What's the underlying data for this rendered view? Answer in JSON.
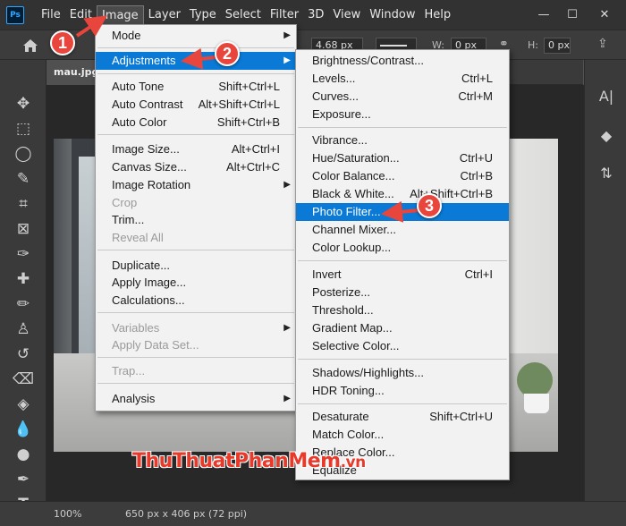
{
  "app": {
    "logo": "Ps"
  },
  "menubar": {
    "items": [
      "File",
      "Edit",
      "Image",
      "Layer",
      "Type",
      "Select",
      "Filter",
      "3D",
      "View",
      "Window",
      "Help"
    ],
    "active_index": 2
  },
  "window_controls": {
    "minimize": "—",
    "maximize": "☐",
    "close": "✕"
  },
  "options_bar": {
    "stroke_width": "4.68 px",
    "w_label": "W:",
    "w_value": "0 px",
    "h_label": "H:",
    "h_value": "0 px"
  },
  "document": {
    "tab_name": "mau.jpg"
  },
  "status": {
    "zoom": "100%",
    "info": "650 px x 406 px (72 ppi)"
  },
  "watermark": {
    "text": "ThuThuatPhanMem",
    "suffix": ".vn"
  },
  "image_menu": {
    "items": [
      {
        "label": "Mode",
        "shortcut": "",
        "submenu": true,
        "disabled": false
      },
      {
        "label": "Adjustments",
        "shortcut": "",
        "submenu": true,
        "disabled": false,
        "highlight": true
      },
      {
        "label": "Auto Tone",
        "shortcut": "Shift+Ctrl+L",
        "disabled": false
      },
      {
        "label": "Auto Contrast",
        "shortcut": "Alt+Shift+Ctrl+L",
        "disabled": false
      },
      {
        "label": "Auto Color",
        "shortcut": "Shift+Ctrl+B",
        "disabled": false
      },
      {
        "label": "Image Size...",
        "shortcut": "Alt+Ctrl+I",
        "disabled": false
      },
      {
        "label": "Canvas Size...",
        "shortcut": "Alt+Ctrl+C",
        "disabled": false
      },
      {
        "label": "Image Rotation",
        "shortcut": "",
        "submenu": true,
        "disabled": false
      },
      {
        "label": "Crop",
        "shortcut": "",
        "disabled": true
      },
      {
        "label": "Trim...",
        "shortcut": "",
        "disabled": false
      },
      {
        "label": "Reveal All",
        "shortcut": "",
        "disabled": true
      },
      {
        "label": "Duplicate...",
        "shortcut": "",
        "disabled": false
      },
      {
        "label": "Apply Image...",
        "shortcut": "",
        "disabled": false
      },
      {
        "label": "Calculations...",
        "shortcut": "",
        "disabled": false
      },
      {
        "label": "Variables",
        "shortcut": "",
        "submenu": true,
        "disabled": true
      },
      {
        "label": "Apply Data Set...",
        "shortcut": "",
        "disabled": true
      },
      {
        "label": "Trap...",
        "shortcut": "",
        "disabled": true
      },
      {
        "label": "Analysis",
        "shortcut": "",
        "submenu": true,
        "disabled": false
      }
    ]
  },
  "adjustments_menu": {
    "items": [
      {
        "label": "Brightness/Contrast...",
        "shortcut": ""
      },
      {
        "label": "Levels...",
        "shortcut": "Ctrl+L"
      },
      {
        "label": "Curves...",
        "shortcut": "Ctrl+M"
      },
      {
        "label": "Exposure...",
        "shortcut": ""
      },
      {
        "label": "Vibrance...",
        "shortcut": ""
      },
      {
        "label": "Hue/Saturation...",
        "shortcut": "Ctrl+U"
      },
      {
        "label": "Color Balance...",
        "shortcut": "Ctrl+B"
      },
      {
        "label": "Black & White...",
        "shortcut": "Alt+Shift+Ctrl+B"
      },
      {
        "label": "Photo Filter...",
        "shortcut": "",
        "highlight": true
      },
      {
        "label": "Channel Mixer...",
        "shortcut": ""
      },
      {
        "label": "Color Lookup...",
        "shortcut": ""
      },
      {
        "label": "Invert",
        "shortcut": "Ctrl+I"
      },
      {
        "label": "Posterize...",
        "shortcut": ""
      },
      {
        "label": "Threshold...",
        "shortcut": ""
      },
      {
        "label": "Gradient Map...",
        "shortcut": ""
      },
      {
        "label": "Selective Color...",
        "shortcut": ""
      },
      {
        "label": "Shadows/Highlights...",
        "shortcut": ""
      },
      {
        "label": "HDR Toning...",
        "shortcut": ""
      },
      {
        "label": "Desaturate",
        "shortcut": "Shift+Ctrl+U"
      },
      {
        "label": "Match Color...",
        "shortcut": ""
      },
      {
        "label": "Replace Color...",
        "shortcut": ""
      },
      {
        "label": "Equalize",
        "shortcut": ""
      }
    ]
  },
  "callouts": [
    "1",
    "2",
    "3"
  ],
  "colors": {
    "highlight": "#0a7ad6",
    "callout": "#e8453c",
    "menu_bg": "#f2f2f2"
  }
}
